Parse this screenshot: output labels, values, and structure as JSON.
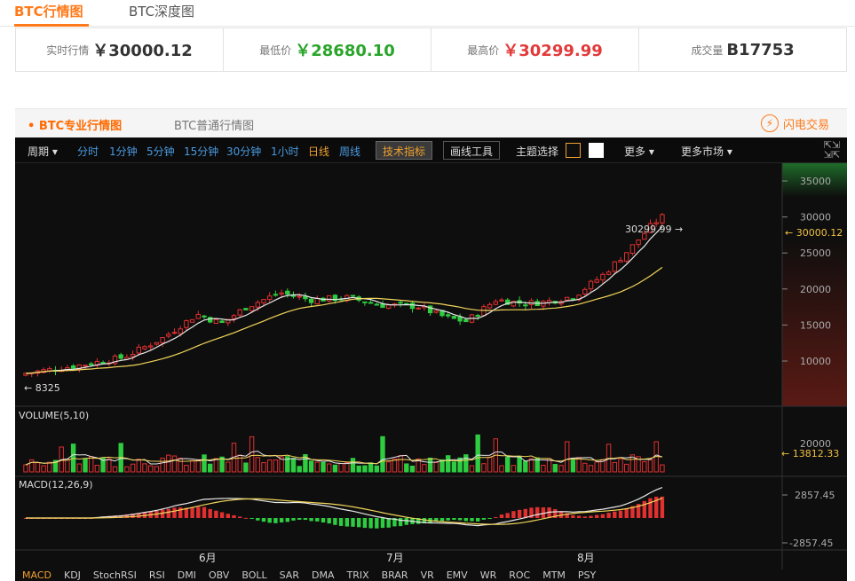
{
  "top_tabs": [
    "BTC行情图",
    "BTC深度图"
  ],
  "stats": [
    {
      "label": "实时行情",
      "value": "￥30000.12",
      "color": "#333333"
    },
    {
      "label": "最低价",
      "value": "￥28680.10",
      "color": "#2aa52a"
    },
    {
      "label": "最高价",
      "value": "￥30299.99",
      "color": "#e23a3a"
    },
    {
      "label": "成交量",
      "value": "B17753",
      "color": "#333333"
    }
  ],
  "panel_tabs": [
    "• BTC专业行情图",
    "BTC普通行情图"
  ],
  "flash_trade": "闪电交易",
  "toolbar": {
    "period": "周期 ▾",
    "intervals": [
      "分时",
      "1分钟",
      "5分钟",
      "15分钟",
      "30分钟",
      "1小时",
      "日线",
      "周线"
    ],
    "active_interval": "日线",
    "tech_btn": "技术指标",
    "draw_btn": "画线工具",
    "theme": "主题选择",
    "more": "更多 ▾",
    "more_market": "更多市场 ▾"
  },
  "chart_data": {
    "type": "candlestick",
    "price_axis_ticks": [
      35000,
      30000,
      25000,
      20000,
      15000,
      10000
    ],
    "current_price": "30000.12",
    "high_label": "30299.99 →",
    "low_label": "← 8325",
    "volume_title": "VOLUME(5,10)",
    "volume_tick": "20000",
    "volume_current": "13812.33",
    "macd_title": "MACD(12,26,9)",
    "macd_ticks": [
      "2857.45",
      "-2857.45"
    ],
    "month_labels": [
      "6月",
      "7月",
      "8月"
    ]
  },
  "indicators": [
    "MACD",
    "KDJ",
    "StochRSI",
    "RSI",
    "DMI",
    "OBV",
    "BOLL",
    "SAR",
    "DMA",
    "TRIX",
    "BRAR",
    "VR",
    "EMV",
    "WR",
    "ROC",
    "MTM",
    "PSY"
  ],
  "colors": {
    "accent": "#ff7a1a",
    "up": "#2ecc40",
    "down": "#e03030",
    "bg": "#0e0e0e"
  }
}
